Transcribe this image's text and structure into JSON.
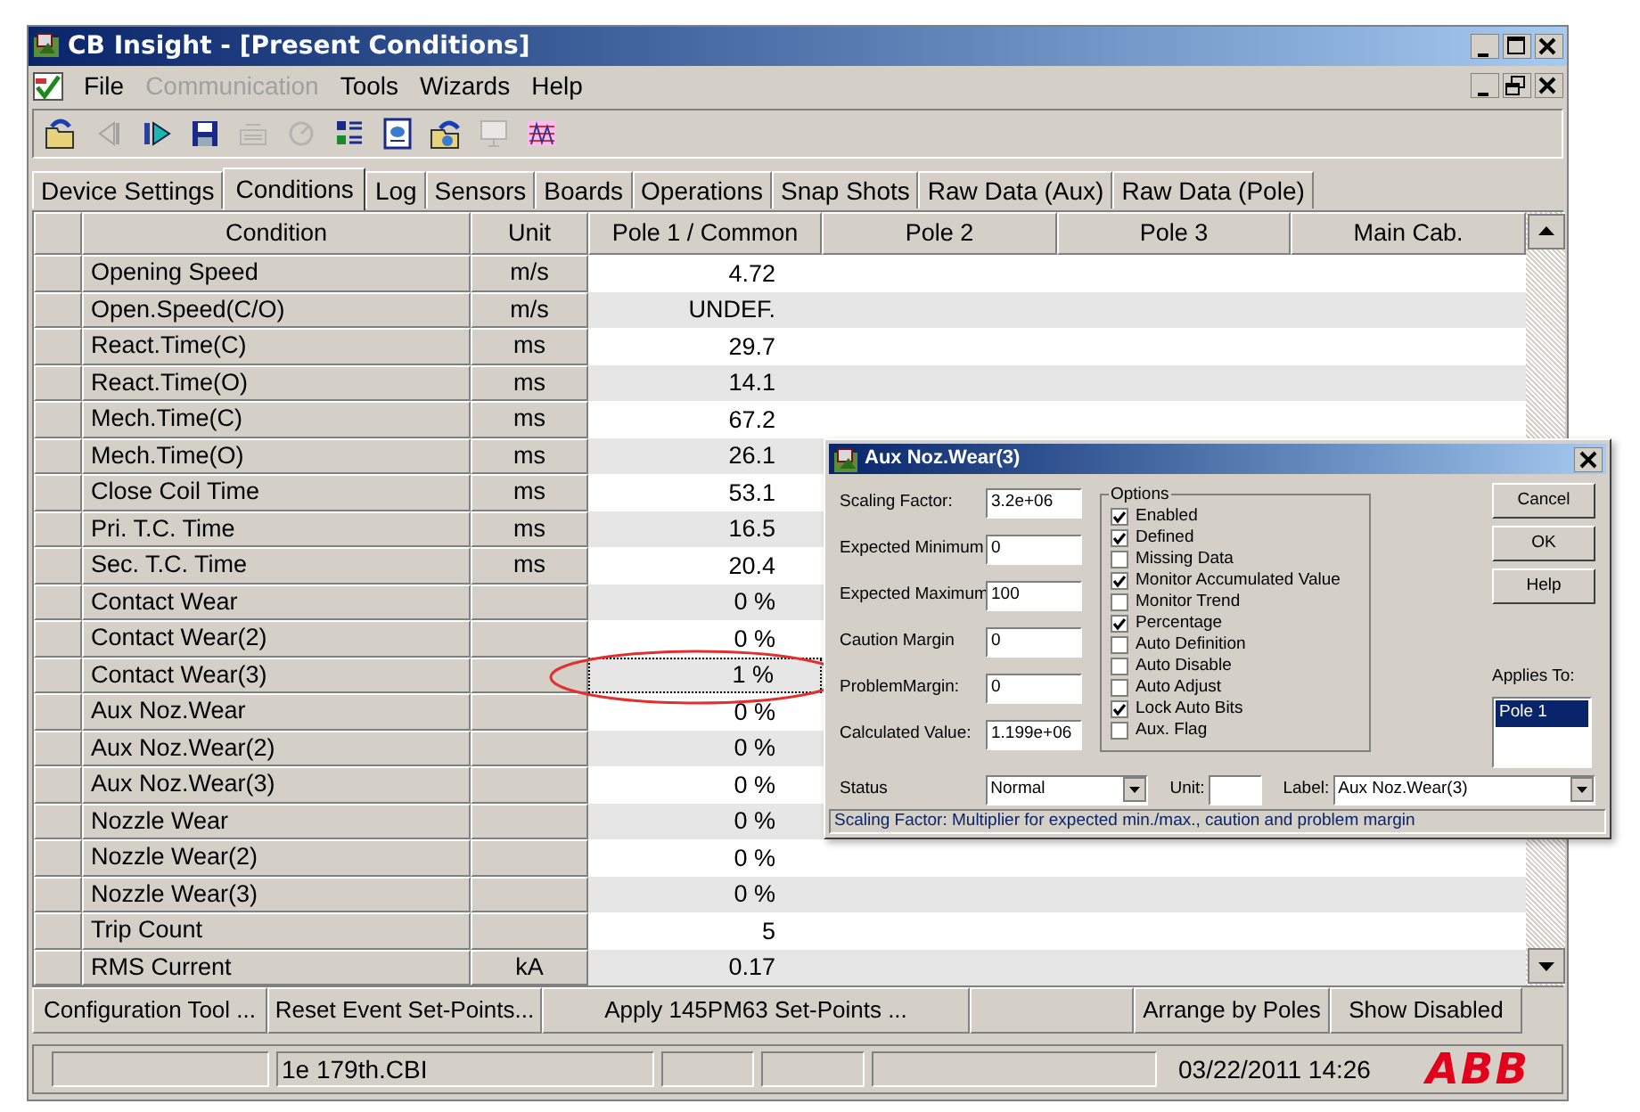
{
  "window": {
    "title": "CB Insight - [Present Conditions]"
  },
  "menu": [
    {
      "label": "File",
      "disabled": false
    },
    {
      "label": "Communication",
      "disabled": true
    },
    {
      "label": "Tools",
      "disabled": false
    },
    {
      "label": "Wizards",
      "disabled": false
    },
    {
      "label": "Help",
      "disabled": false
    }
  ],
  "toolbar": [
    {
      "kind": "open",
      "disabled": false
    },
    {
      "kind": "back",
      "disabled": true
    },
    {
      "kind": "forward",
      "disabled": false
    },
    {
      "kind": "save",
      "disabled": false
    },
    {
      "kind": "printer",
      "disabled": true
    },
    {
      "kind": "gauge",
      "disabled": true
    },
    {
      "kind": "list",
      "disabled": false
    },
    {
      "kind": "document",
      "disabled": false
    },
    {
      "kind": "refresh",
      "disabled": false
    },
    {
      "kind": "monitor",
      "disabled": true
    },
    {
      "kind": "chart",
      "disabled": false
    }
  ],
  "tabs": [
    {
      "label": "Device Settings",
      "selected": false
    },
    {
      "label": "Conditions",
      "selected": true
    },
    {
      "label": "Log",
      "selected": false
    },
    {
      "label": "Sensors",
      "selected": false
    },
    {
      "label": "Boards",
      "selected": false
    },
    {
      "label": "Operations",
      "selected": false
    },
    {
      "label": "Snap Shots",
      "selected": false
    },
    {
      "label": "Raw Data (Aux)",
      "selected": false
    },
    {
      "label": "Raw Data (Pole)",
      "selected": false
    }
  ],
  "table": {
    "columns": [
      "Condition",
      "Unit",
      "Pole 1 / Common",
      "Pole 2",
      "Pole 3",
      "Main Cab."
    ],
    "rows": [
      {
        "condition": "Opening Speed",
        "unit": "m/s",
        "pole_1": "4.72",
        "selected": false
      },
      {
        "condition": "Open.Speed(C/O)",
        "unit": "m/s",
        "pole_1": "UNDEF.",
        "selected": false
      },
      {
        "condition": "React.Time(C)",
        "unit": "ms",
        "pole_1": "29.7",
        "selected": false
      },
      {
        "condition": "React.Time(O)",
        "unit": "ms",
        "pole_1": "14.1",
        "selected": false
      },
      {
        "condition": "Mech.Time(C)",
        "unit": "ms",
        "pole_1": "67.2",
        "selected": false
      },
      {
        "condition": "Mech.Time(O)",
        "unit": "ms",
        "pole_1": "26.1",
        "selected": false
      },
      {
        "condition": "Close Coil Time",
        "unit": "ms",
        "pole_1": "53.1",
        "selected": false
      },
      {
        "condition": "Pri. T.C. Time",
        "unit": "ms",
        "pole_1": "16.5",
        "selected": false
      },
      {
        "condition": "Sec. T.C. Time",
        "unit": "ms",
        "pole_1": "20.4",
        "selected": false
      },
      {
        "condition": "Contact Wear",
        "pole_1": "0 %",
        "selected": false
      },
      {
        "condition": "Contact Wear(2)",
        "pole_1": "0 %",
        "selected": false
      },
      {
        "condition": "Contact Wear(3)",
        "pole_1": "1 %",
        "selected": true
      },
      {
        "condition": "Aux Noz.Wear",
        "pole_1": "0 %",
        "selected": false
      },
      {
        "condition": "Aux Noz.Wear(2)",
        "pole_1": "0 %",
        "selected": false
      },
      {
        "condition": "Aux Noz.Wear(3)",
        "pole_1": "0 %",
        "selected": false
      },
      {
        "condition": "Nozzle Wear",
        "pole_1": "0 %",
        "selected": false
      },
      {
        "condition": "Nozzle Wear(2)",
        "pole_1": "0 %",
        "selected": false
      },
      {
        "condition": "Nozzle Wear(3)",
        "pole_1": "0 %",
        "selected": false
      },
      {
        "condition": "Trip Count",
        "pole_1": "5",
        "selected": false
      },
      {
        "condition": "RMS Current",
        "unit": "kA",
        "pole_1": "0.17",
        "selected": false
      }
    ]
  },
  "buttons": [
    "Configuration Tool ...",
    "Reset Event Set-Points...",
    "Apply 145PM63 Set-Points ...",
    "Arrange by Poles",
    "Show Disabled"
  ],
  "status_bar": {
    "file": "1e 179th.CBI",
    "datetime": "03/22/2011 14:26",
    "logo": "ABB"
  },
  "dialog": {
    "title": "Aux Noz.Wear(3)",
    "fields": [
      {
        "label": "Scaling Factor:",
        "value": "3.2e+06"
      },
      {
        "label": "Expected Minimum",
        "value": "0"
      },
      {
        "label": "Expected Maximum",
        "value": "100"
      },
      {
        "label": "Caution Margin",
        "value": "0"
      },
      {
        "label": "ProblemMargin:",
        "value": "0"
      },
      {
        "label": "Calculated Value:",
        "value": "1.199e+06"
      }
    ],
    "options_title": "Options",
    "options": [
      {
        "label": "Enabled",
        "checked": true
      },
      {
        "label": "Defined",
        "checked": true
      },
      {
        "label": "Missing Data",
        "checked": false
      },
      {
        "label": "Monitor Accumulated Value",
        "checked": true
      },
      {
        "label": "Monitor Trend",
        "checked": false
      },
      {
        "label": "Percentage",
        "checked": true
      },
      {
        "label": "Auto Definition",
        "checked": false
      },
      {
        "label": "Auto Disable",
        "checked": false
      },
      {
        "label": "Auto Adjust",
        "checked": false
      },
      {
        "label": "Lock Auto Bits",
        "checked": true
      },
      {
        "label": "Aux. Flag",
        "checked": false
      }
    ],
    "buttons": [
      "Cancel",
      "OK",
      "Help"
    ],
    "applies_to": {
      "label": "Applies To:",
      "items": [
        {
          "label": "Pole 1",
          "selected": true
        }
      ]
    },
    "status": {
      "label": "Status",
      "value": "Normal"
    },
    "unit_label": "Unit:",
    "label": {
      "label": "Label:",
      "value": "Aux Noz.Wear(3)"
    },
    "hint": "Scaling Factor: Multiplier for expected min./max., caution and problem margin"
  }
}
